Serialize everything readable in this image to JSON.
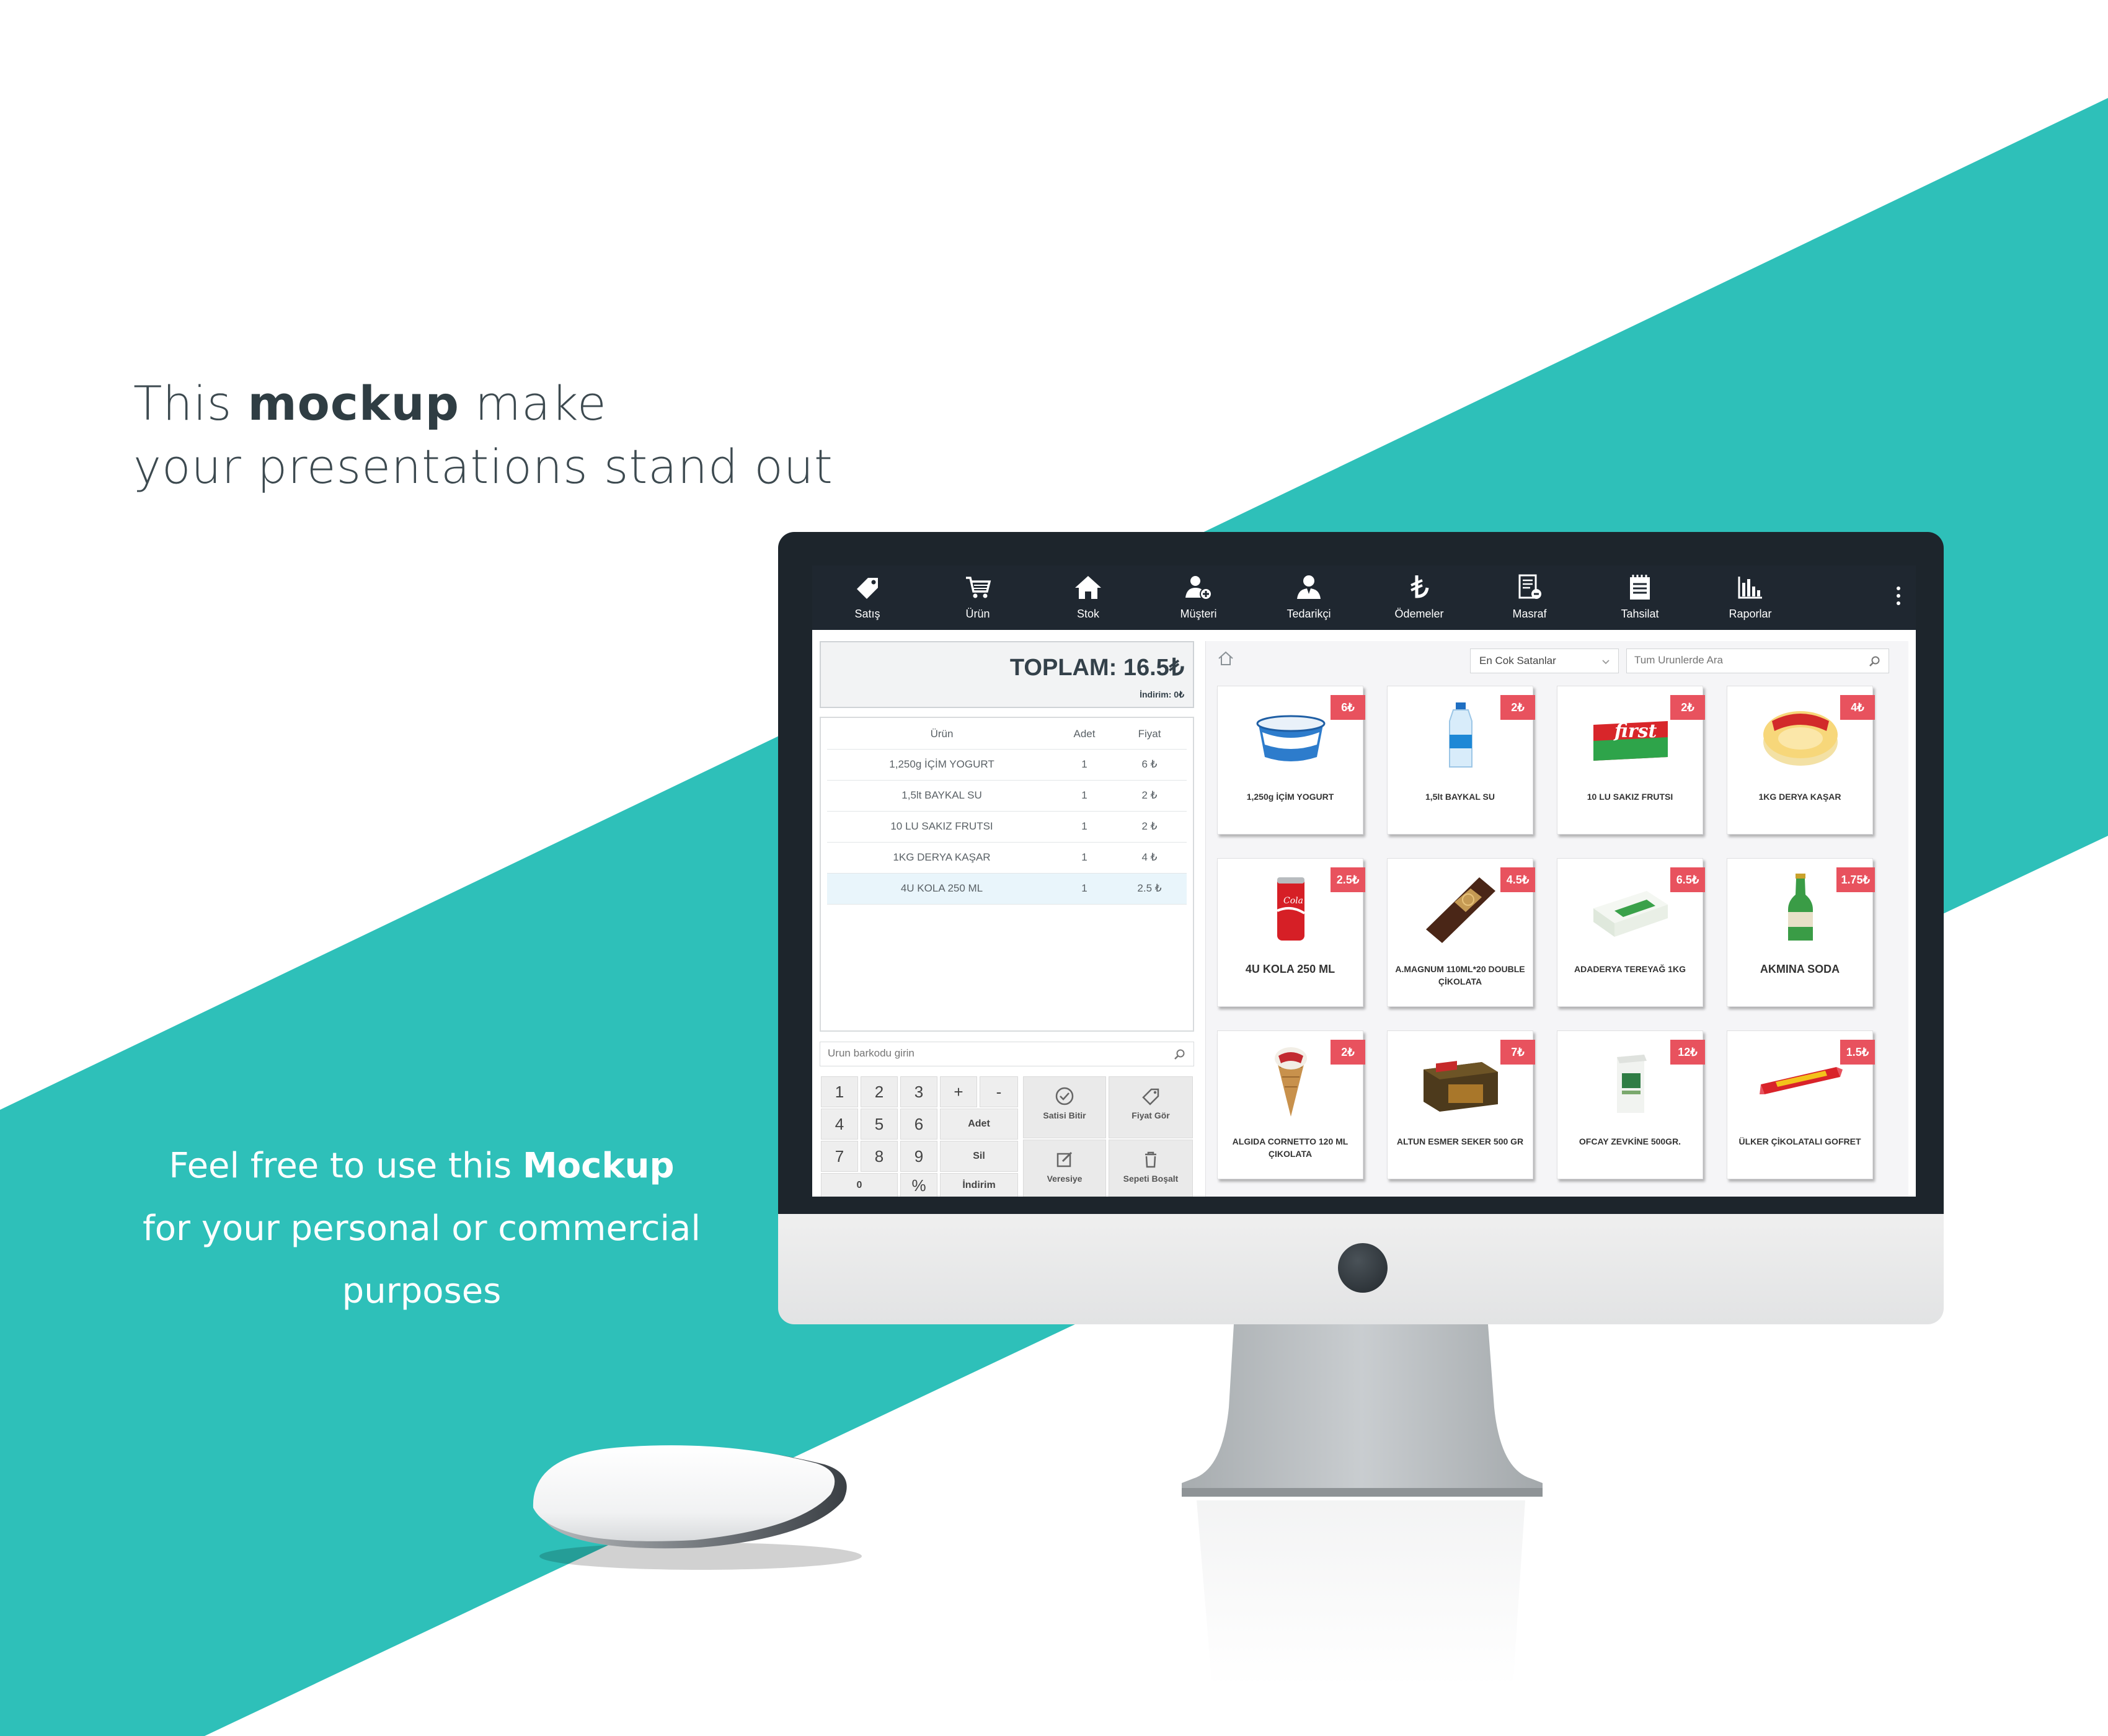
{
  "colors": {
    "teal": "#2ec0b9",
    "nav_bg": "#1f2730",
    "badge": "#e8525e"
  },
  "headline": {
    "pre": "This ",
    "bold": "mockup",
    "post": " make",
    "line2": "your presentations  stand out"
  },
  "subcopy": {
    "pre": "Feel free to use this ",
    "bold": "Mockup",
    "line2": "for your personal or commercial",
    "line3": "purposes"
  },
  "app": {
    "nav": [
      {
        "label": "Satış",
        "icon": "tag-icon"
      },
      {
        "label": "Ürün",
        "icon": "cart-icon"
      },
      {
        "label": "Stok",
        "icon": "home-icon"
      },
      {
        "label": "Müşteri",
        "icon": "user-add-icon"
      },
      {
        "label": "Tedarikçi",
        "icon": "supplier-icon"
      },
      {
        "label": "Ödemeler",
        "icon": "lira-icon"
      },
      {
        "label": "Masraf",
        "icon": "receipt-icon"
      },
      {
        "label": "Tahsilat",
        "icon": "notepad-icon"
      },
      {
        "label": "Raporlar",
        "icon": "bar-chart-icon"
      }
    ],
    "total": {
      "label": "TOPLAM: 16.5₺",
      "discount": "İndirim: 0₺"
    },
    "cart": {
      "headers": [
        "Ürün",
        "Adet",
        "Fiyat"
      ],
      "rows": [
        [
          "1,250g İÇİM YOGURT",
          "1",
          "6 ₺"
        ],
        [
          "1,5lt BAYKAL SU",
          "1",
          "2 ₺"
        ],
        [
          "10 LU SAKIZ FRUTSI",
          "1",
          "2 ₺"
        ],
        [
          "1KG DERYA KAŞAR",
          "1",
          "4 ₺"
        ],
        [
          "4U KOLA 250 ML",
          "1",
          "2.5 ₺"
        ]
      ]
    },
    "barcode_placeholder": "Urun barkodu girin",
    "keypad": {
      "digits": [
        "1",
        "2",
        "3",
        "4",
        "5",
        "6",
        "7",
        "8",
        "9",
        "0"
      ],
      "plus": "+",
      "minus": "-",
      "percent": "%",
      "adet": "Adet",
      "sil": "Sil",
      "indirim": "İndirim",
      "finish": "Satisi Bitir",
      "price": "Fiyat Gör",
      "credit": "Veresiye",
      "empty": "Sepeti Boşalt"
    },
    "filter": "En Cok Satanlar",
    "search_placeholder": "Tum Urunlerde Ara",
    "products": [
      {
        "name": "1,250g İÇİM YOGURT",
        "price": "6₺",
        "icon": "yogurt-icon"
      },
      {
        "name": "1,5lt BAYKAL SU",
        "price": "2₺",
        "icon": "water-bottle-icon"
      },
      {
        "name": "10 LU SAKIZ FRUTSI",
        "price": "2₺",
        "icon": "gum-pack-icon"
      },
      {
        "name": "1KG DERYA KAŞAR",
        "price": "4₺",
        "icon": "cheese-icon"
      },
      {
        "name": "4U KOLA 250 ML",
        "price": "2.5₺",
        "icon": "cola-can-icon"
      },
      {
        "name": "A.MAGNUM 110ML*20 DOUBLE ÇİKOLATA",
        "price": "4.5₺",
        "icon": "ice-cream-bar-icon"
      },
      {
        "name": "ADADERYA TEREYAĞ 1KG",
        "price": "6.5₺",
        "icon": "butter-icon"
      },
      {
        "name": "AKMINA SODA",
        "price": "1.75₺",
        "icon": "soda-bottle-icon"
      },
      {
        "name": "ALGIDA CORNETTO 120 ML ÇIKOLATA",
        "price": "2₺",
        "icon": "cone-icon"
      },
      {
        "name": "ALTUN ESMER SEKER 500 GR",
        "price": "7₺",
        "icon": "sugar-box-icon"
      },
      {
        "name": "OFCAY ZEVKİNE 500GR.",
        "price": "12₺",
        "icon": "tea-pack-icon"
      },
      {
        "name": "ÜLKER ÇİKOLATALI GOFRET",
        "price": "1.5₺",
        "icon": "wafer-icon"
      }
    ]
  }
}
